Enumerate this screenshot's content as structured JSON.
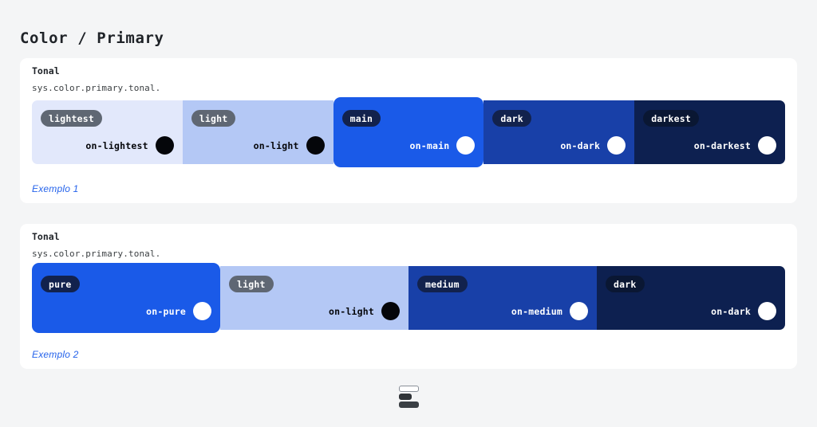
{
  "page": {
    "title": "Color / Primary",
    "background_color": "#f4f5f6"
  },
  "cards": [
    {
      "label": "Tonal",
      "token": "sys.color.primary.tonal.",
      "example_link": "Exemplo 1",
      "swatches": [
        {
          "name": "lightest",
          "on_label": "on-lightest",
          "bg": "#e2e8fb",
          "badge_bg": "#5f6773",
          "badge_fg": "#ffffff",
          "on_fg": "#05060a",
          "dot": "#05060a",
          "selected": false
        },
        {
          "name": "light",
          "on_label": "on-light",
          "bg": "#b4c8f5",
          "badge_bg": "#5f6773",
          "badge_fg": "#ffffff",
          "on_fg": "#05060a",
          "dot": "#05060a",
          "selected": false
        },
        {
          "name": "main",
          "on_label": "on-main",
          "bg": "#1a5ae8",
          "badge_bg": "#12224d",
          "badge_fg": "#ffffff",
          "on_fg": "#ffffff",
          "dot": "#ffffff",
          "selected": true
        },
        {
          "name": "dark",
          "on_label": "on-dark",
          "bg": "#1840a8",
          "badge_bg": "#12224d",
          "badge_fg": "#ffffff",
          "on_fg": "#ffffff",
          "dot": "#ffffff",
          "selected": false
        },
        {
          "name": "darkest",
          "on_label": "on-darkest",
          "bg": "#0d2050",
          "badge_bg": "#0a1733",
          "badge_fg": "#ffffff",
          "on_fg": "#ffffff",
          "dot": "#ffffff",
          "selected": false
        }
      ]
    },
    {
      "label": "Tonal",
      "token": "sys.color.primary.tonal.",
      "example_link": "Exemplo 2",
      "swatches": [
        {
          "name": "pure",
          "on_label": "on-pure",
          "bg": "#1a5ae8",
          "badge_bg": "#12224d",
          "badge_fg": "#ffffff",
          "on_fg": "#ffffff",
          "dot": "#ffffff",
          "selected": true
        },
        {
          "name": "light",
          "on_label": "on-light",
          "bg": "#b4c8f5",
          "badge_bg": "#5f6773",
          "badge_fg": "#ffffff",
          "on_fg": "#05060a",
          "dot": "#05060a",
          "selected": false
        },
        {
          "name": "medium",
          "on_label": "on-medium",
          "bg": "#1840a8",
          "badge_bg": "#12224d",
          "badge_fg": "#ffffff",
          "on_fg": "#ffffff",
          "dot": "#ffffff",
          "selected": false
        },
        {
          "name": "dark",
          "on_label": "on-dark",
          "bg": "#0d2050",
          "badge_bg": "#0a1733",
          "badge_fg": "#ffffff",
          "on_fg": "#ffffff",
          "dot": "#ffffff",
          "selected": false
        }
      ]
    }
  ],
  "bottom_widget": {
    "icon": "theme-toggle-icon"
  }
}
